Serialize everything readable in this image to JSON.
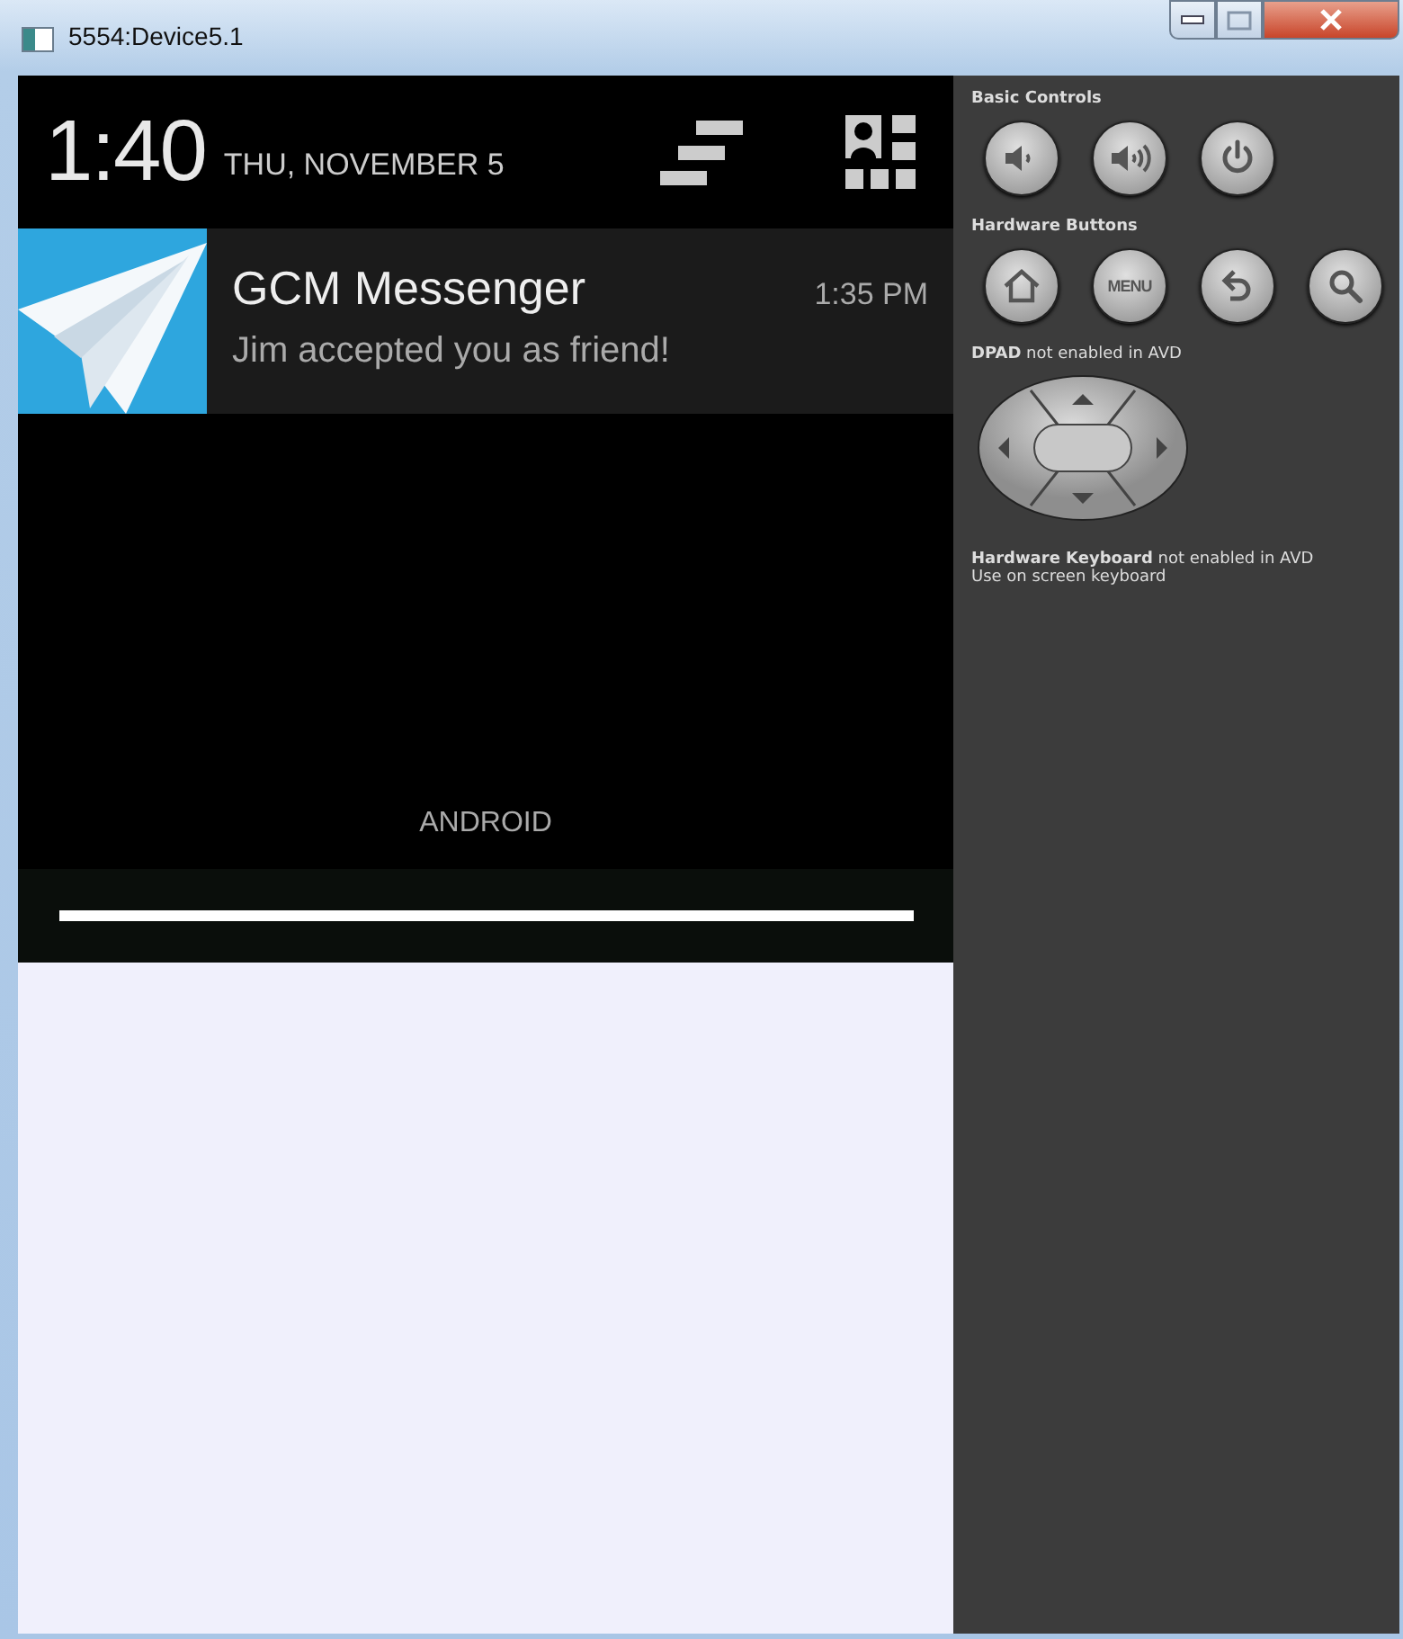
{
  "window": {
    "title": "5554:Device5.1"
  },
  "status_header": {
    "time": "1:40",
    "date": "THU, NOVEMBER 5"
  },
  "notifications": [
    {
      "title": "GCM Messenger",
      "time": "1:35 PM",
      "text": "Jim accepted you as friend!"
    }
  ],
  "carrier_label": "ANDROID",
  "controls": {
    "sections": [
      {
        "heading": "Basic Controls",
        "buttons": [
          {
            "kind": "volume-down"
          },
          {
            "kind": "volume-up"
          },
          {
            "kind": "power"
          }
        ]
      },
      {
        "heading": "Hardware Buttons",
        "buttons": [
          {
            "kind": "home"
          },
          {
            "kind": "menu",
            "label": "MENU"
          },
          {
            "kind": "back"
          },
          {
            "kind": "search"
          }
        ]
      }
    ],
    "dpad_note": "**DPAD** not enabled in AVD",
    "keyboard_notes": [
      "**Hardware Keyboard** not enabled in AVD",
      "Use on screen keyboard"
    ]
  }
}
